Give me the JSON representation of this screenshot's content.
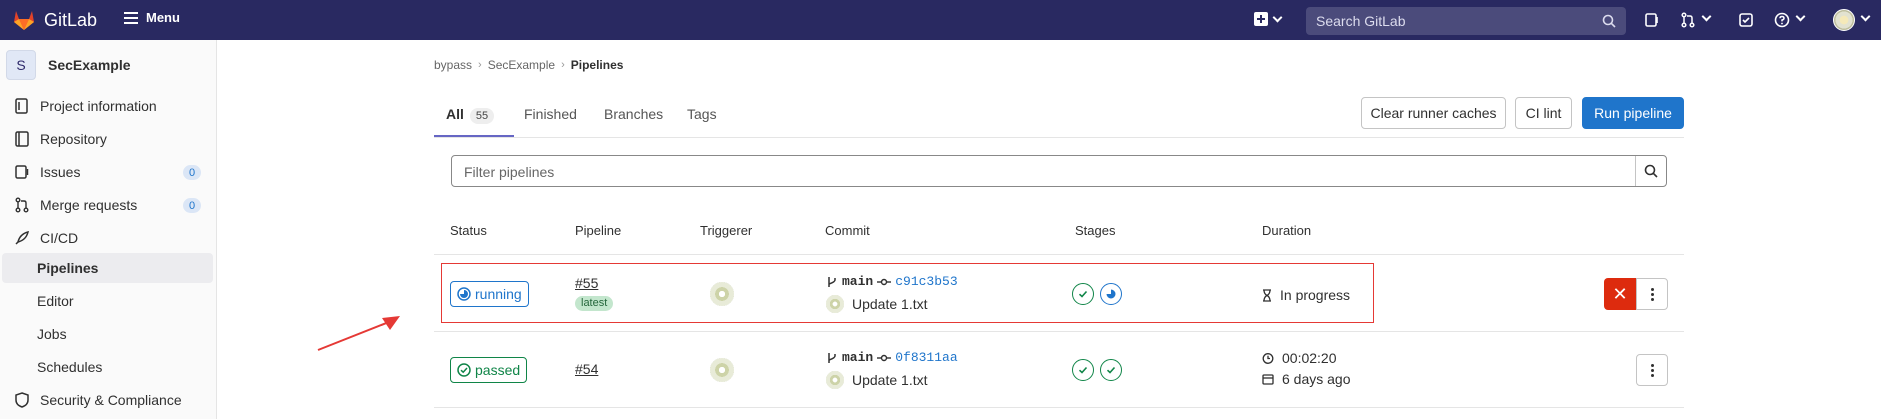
{
  "topbar": {
    "brand": "GitLab",
    "menu_label": "Menu",
    "search_placeholder": "Search GitLab",
    "bg_color": "#292961"
  },
  "sidebar": {
    "project_initial": "S",
    "project_name": "SecExample",
    "items": [
      {
        "label": "Project information",
        "icon": "info-icon"
      },
      {
        "label": "Repository",
        "icon": "book-icon"
      },
      {
        "label": "Issues",
        "icon": "issues-icon",
        "count": "0"
      },
      {
        "label": "Merge requests",
        "icon": "merge-request-icon",
        "count": "0"
      },
      {
        "label": "CI/CD",
        "icon": "rocket-icon"
      },
      {
        "label": "Pipelines",
        "active": true
      },
      {
        "label": "Editor"
      },
      {
        "label": "Jobs"
      },
      {
        "label": "Schedules"
      },
      {
        "label": "Security & Compliance",
        "icon": "shield-icon"
      }
    ]
  },
  "breadcrumb": {
    "items": [
      "bypass",
      "SecExample",
      "Pipelines"
    ]
  },
  "tabs": {
    "all": "All",
    "all_count": "55",
    "finished": "Finished",
    "branches": "Branches",
    "tags": "Tags"
  },
  "actions": {
    "clear_cache": "Clear runner caches",
    "ci_lint": "CI lint",
    "run_pipeline": "Run pipeline"
  },
  "filter": {
    "placeholder": "Filter pipelines"
  },
  "table": {
    "headers": {
      "status": "Status",
      "pipeline": "Pipeline",
      "triggerer": "Triggerer",
      "commit": "Commit",
      "stages": "Stages",
      "duration": "Duration"
    },
    "rows": [
      {
        "status": "running",
        "id": "#55",
        "tag": "latest",
        "branch": "main",
        "sha": "c91c3b53",
        "message": "Update 1.txt",
        "duration": "In progress"
      },
      {
        "status": "passed",
        "id": "#54",
        "branch": "main",
        "sha": "0f8311aa",
        "message": "Update 1.txt",
        "duration": "00:02:20",
        "finished": "6 days ago"
      }
    ]
  },
  "colors": {
    "primary": "#1f75cb",
    "success": "#108548",
    "danger": "#dd2b0e",
    "annotation": "#e53935"
  }
}
